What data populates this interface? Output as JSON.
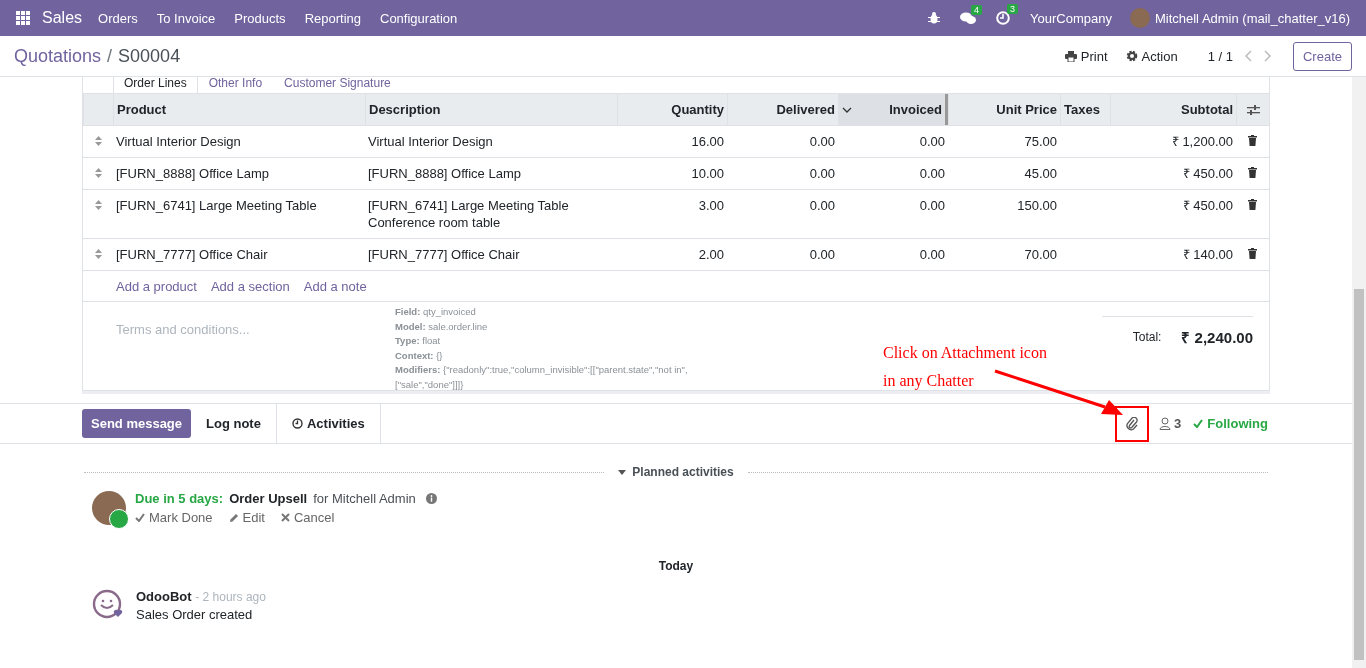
{
  "navbar": {
    "app": "Sales",
    "menu": [
      "Orders",
      "To Invoice",
      "Products",
      "Reporting",
      "Configuration"
    ],
    "messages_badge": "4",
    "activities_badge": "3",
    "company": "YourCompany",
    "user": "Mitchell Admin (mail_chatter_v16)"
  },
  "breadcrumb": {
    "parent": "Quotations",
    "separator": "/",
    "current": "S00004"
  },
  "actions": {
    "print": "Print",
    "action": "Action",
    "pager": "1 / 1",
    "create": "Create"
  },
  "tabs": [
    {
      "label": "Order Lines",
      "selected": true
    },
    {
      "label": "Other Info",
      "selected": false
    },
    {
      "label": "Customer Signature",
      "selected": false
    }
  ],
  "table": {
    "columns": [
      "Product",
      "Description",
      "Quantity",
      "Delivered",
      "Invoiced",
      "Unit Price",
      "Taxes",
      "Subtotal"
    ],
    "rows": [
      {
        "product": "Virtual Interior Design",
        "description": "Virtual Interior Design",
        "quantity": "16.00",
        "delivered": "0.00",
        "invoiced": "0.00",
        "unit_price": "75.00",
        "subtotal": "₹ 1,200.00"
      },
      {
        "product": "[FURN_8888] Office Lamp",
        "description": "[FURN_8888] Office Lamp",
        "quantity": "10.00",
        "delivered": "0.00",
        "invoiced": "0.00",
        "unit_price": "45.00",
        "subtotal": "₹ 450.00"
      },
      {
        "product": "[FURN_6741] Large Meeting Table",
        "description": "[FURN_6741] Large Meeting Table\nConference room table",
        "quantity": "3.00",
        "delivered": "0.00",
        "invoiced": "0.00",
        "unit_price": "150.00",
        "subtotal": "₹ 450.00"
      },
      {
        "product": "[FURN_7777] Office Chair",
        "description": "[FURN_7777] Office Chair",
        "quantity": "2.00",
        "delivered": "0.00",
        "invoiced": "0.00",
        "unit_price": "70.00",
        "subtotal": "₹ 140.00"
      }
    ]
  },
  "add_links": [
    "Add a product",
    "Add a section",
    "Add a note"
  ],
  "tooltip": {
    "items": [
      {
        "label": "Field:",
        "value": "qty_invoiced"
      },
      {
        "label": "Model:",
        "value": "sale.order.line"
      },
      {
        "label": "Type:",
        "value": "float"
      },
      {
        "label": "Context:",
        "value": "{}"
      },
      {
        "label": "Modifiers:",
        "value": "{\"readonly\":true,\"column_invisible\":[[\"parent.state\",\"not in\",[\"sale\",\"done\"]]]}"
      }
    ]
  },
  "terms": {
    "placeholder": "Terms and conditions..."
  },
  "total": {
    "label": "Total:",
    "value": "₹ 2,240.00"
  },
  "annotation": {
    "lines": [
      "Click on Attachment icon",
      "in any Chatter"
    ]
  },
  "chatter": {
    "buttons": [
      {
        "label": "Send message",
        "selected": true
      },
      {
        "label": "Log note",
        "selected": false
      },
      {
        "label": "Activities",
        "selected": false
      }
    ],
    "followers": "3",
    "following": "Following",
    "planned_title": "Planned activities",
    "activity": {
      "due": "Due in 5 days:",
      "summary": "Order Upsell",
      "assignee": "for Mitchell Admin",
      "actions": [
        "Mark Done",
        "Edit",
        "Cancel"
      ]
    },
    "date_separator": "Today",
    "messages": [
      {
        "author": "OdooBot",
        "time": "- 2 hours ago",
        "body": "Sales Order created"
      }
    ]
  }
}
